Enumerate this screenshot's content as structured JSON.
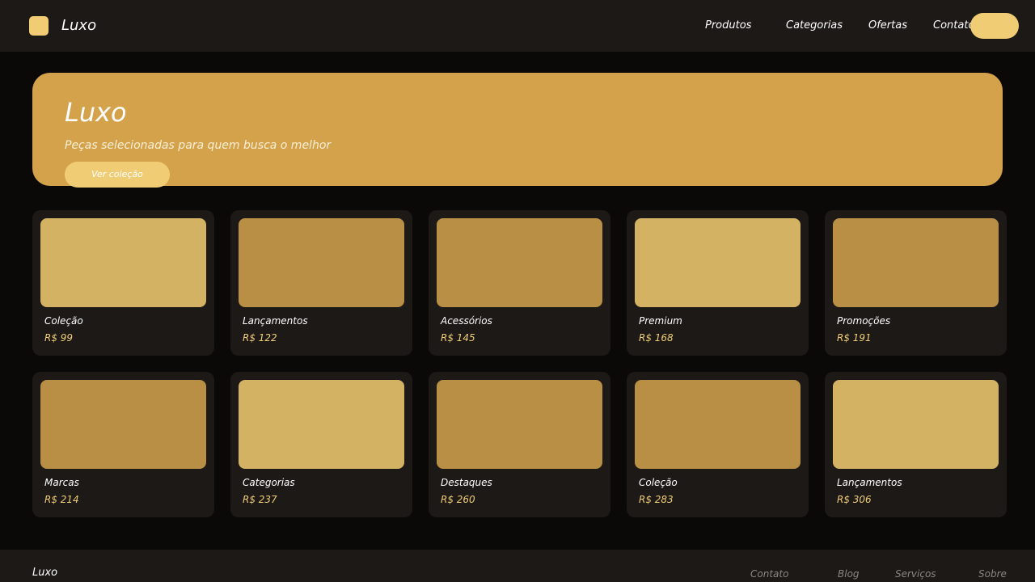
{
  "header": {
    "brand": "Luxo",
    "nav": [
      "Produtos",
      "Categorias",
      "Ofertas",
      "Contato"
    ]
  },
  "hero": {
    "title": "Luxo",
    "subtitle": "Peças selecionadas para quem busca o melhor",
    "button_label": "Ver coleção"
  },
  "products": [
    {
      "name": "Coleção",
      "price": "R$ 99"
    },
    {
      "name": "Lançamentos",
      "price": "R$ 122"
    },
    {
      "name": "Acessórios",
      "price": "R$ 145"
    },
    {
      "name": "Premium",
      "price": "R$ 168"
    },
    {
      "name": "Promoções",
      "price": "R$ 191"
    },
    {
      "name": "Marcas",
      "price": "R$ 214"
    },
    {
      "name": "Categorias",
      "price": "R$ 237"
    },
    {
      "name": "Destaques",
      "price": "R$ 260"
    },
    {
      "name": "Coleção",
      "price": "R$ 283"
    },
    {
      "name": "Lançamentos",
      "price": "R$ 306"
    }
  ],
  "footer": {
    "brand": "Luxo",
    "links": [
      "Contato",
      "Blog",
      "Serviços",
      "Sobre"
    ]
  },
  "colors": {
    "accent": "#f0cd75",
    "hero_bg": "#d4a24b",
    "image_light": "#d3b264",
    "image_dark": "#b98f45",
    "surface": "#1c1917",
    "background": "#0a0908"
  }
}
